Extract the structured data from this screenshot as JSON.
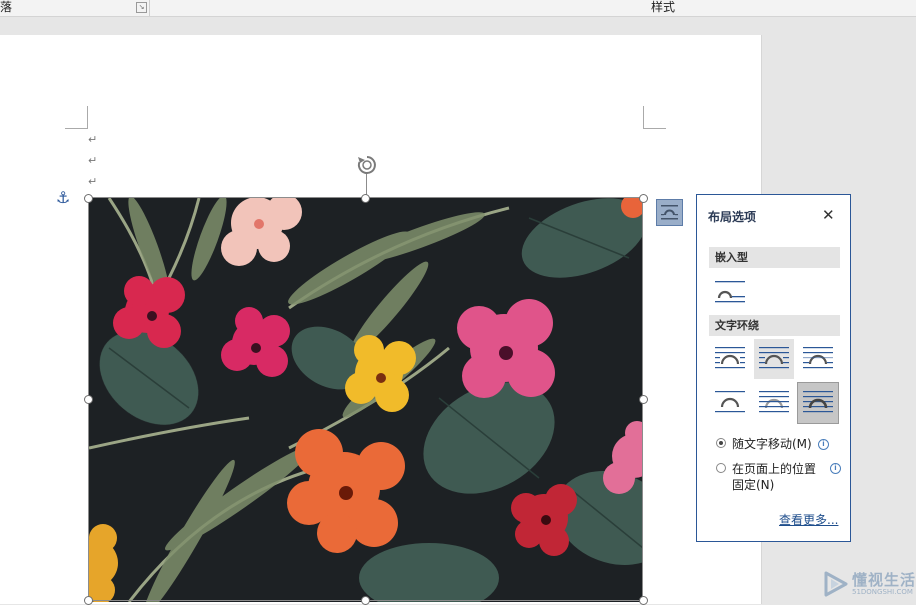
{
  "ribbon": {
    "left_label": "落",
    "right_label": "样式"
  },
  "document": {
    "paragraph_mark": "↵"
  },
  "layout_popup": {
    "title": "布局选项",
    "close_symbol": "✕",
    "inline_section": "嵌入型",
    "wrap_section": "文字环绕",
    "radio_move": "随文字移动(M)",
    "radio_fixed_line1": "在页面上的位置",
    "radio_fixed_line2": "固定(N)",
    "see_more": "查看更多...",
    "info_glyph": "i"
  },
  "watermark": {
    "text": "懂视生活",
    "subtext": "51DONGSHI.COM"
  },
  "colors": {
    "accent": "#2b5797",
    "selected_option": "#c6c6c6",
    "image_bg": "#1d2124"
  }
}
